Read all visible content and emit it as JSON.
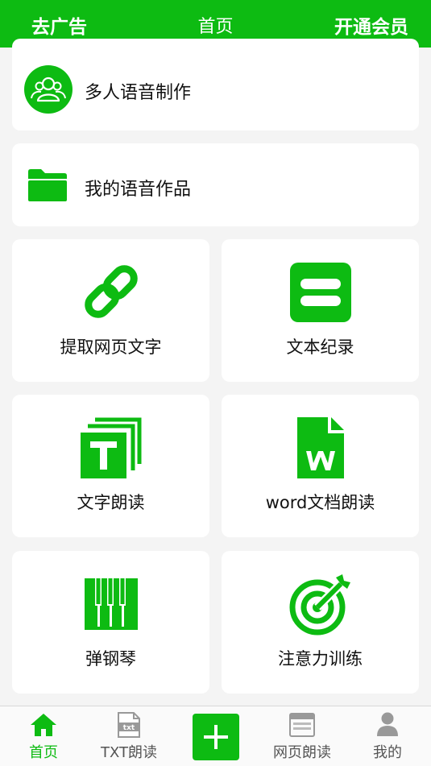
{
  "topbar": {
    "left_label": "去广告",
    "title": "首页",
    "right_label": "开通会员"
  },
  "rows": [
    {
      "label": "多人语音制作",
      "icon": "group-users-icon"
    },
    {
      "label": "我的语音作品",
      "icon": "folder-icon"
    }
  ],
  "tiles": [
    {
      "label": "提取网页文字",
      "icon": "link-icon"
    },
    {
      "label": "文本纪录",
      "icon": "text-record-icon"
    },
    {
      "label": "文字朗读",
      "icon": "text-t-icon"
    },
    {
      "label": "word文档朗读",
      "icon": "word-document-icon"
    },
    {
      "label": "弹钢琴",
      "icon": "piano-icon"
    },
    {
      "label": "注意力训练",
      "icon": "target-icon"
    }
  ],
  "bottom_nav": [
    {
      "label": "首页",
      "icon": "home-icon",
      "active": true
    },
    {
      "label": "TXT朗读",
      "icon": "txt-file-icon",
      "active": false
    },
    {
      "label": "",
      "icon": "plus-icon",
      "active": false
    },
    {
      "label": "网页朗读",
      "icon": "webpage-icon",
      "active": false
    },
    {
      "label": "我的",
      "icon": "profile-icon",
      "active": false
    }
  ],
  "colors": {
    "accent": "#0dbb12",
    "background": "#f4f4f4",
    "card": "#ffffff"
  }
}
